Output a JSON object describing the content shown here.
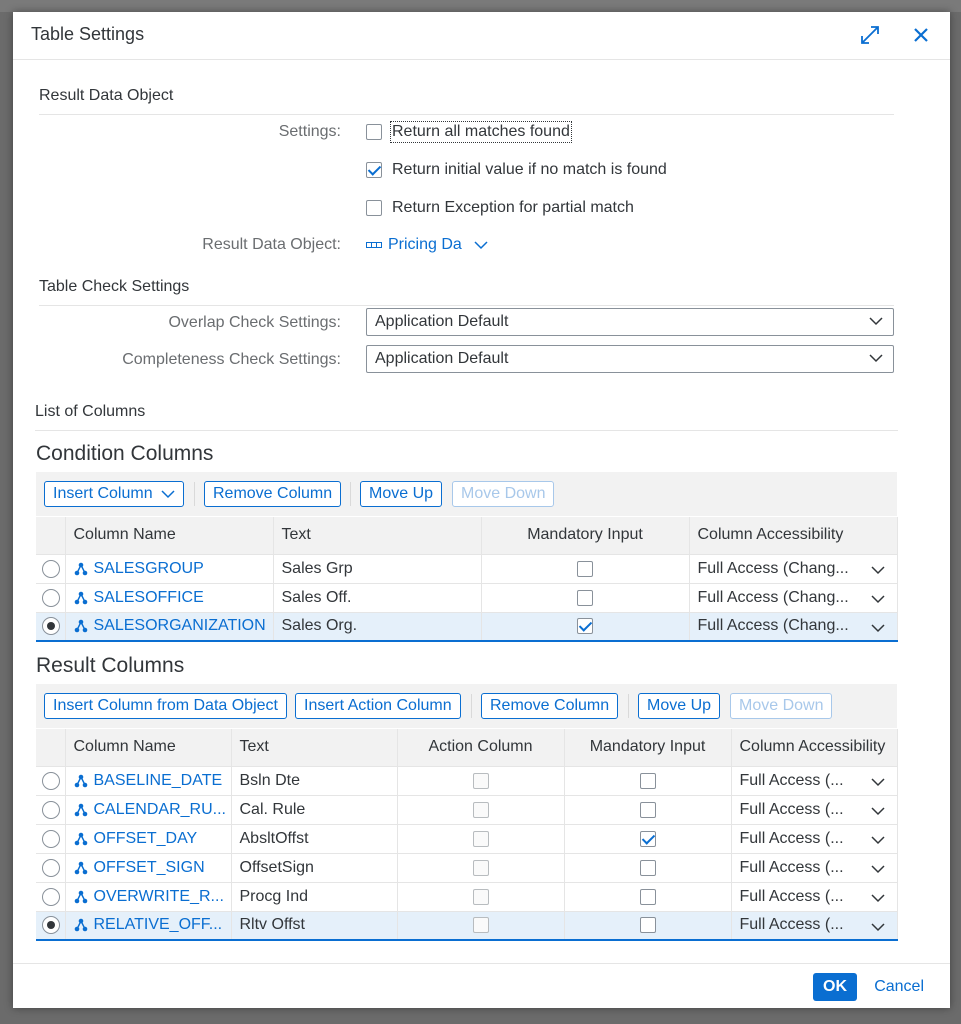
{
  "dialog": {
    "title": "Table Settings",
    "ok_label": "OK",
    "cancel_label": "Cancel"
  },
  "result_data_object": {
    "section_title": "Result Data Object",
    "settings_label": "Settings:",
    "options": [
      {
        "label": "Return all matches found",
        "checked": false
      },
      {
        "label": "Return initial value if no match is found",
        "checked": true
      },
      {
        "label": "Return Exception for partial match",
        "checked": false
      }
    ],
    "rdo_label": "Result Data Object:",
    "rdo_value": "Pricing Da"
  },
  "table_check": {
    "section_title": "Table Check Settings",
    "overlap_label": "Overlap Check Settings:",
    "overlap_value": "Application Default",
    "completeness_label": "Completeness Check Settings:",
    "completeness_value": "Application Default"
  },
  "list_of_columns": "List of Columns",
  "condition_columns": {
    "title": "Condition Columns",
    "toolbar": {
      "insert": "Insert Column",
      "remove": "Remove Column",
      "up": "Move Up",
      "down": "Move Down"
    },
    "headers": [
      "Column Name",
      "Text",
      "Mandatory Input",
      "Column Accessibility"
    ],
    "rows": [
      {
        "name": "SALESGROUP",
        "text": "Sales Grp",
        "mandatory": false,
        "access": "Full Access (Chang...",
        "selected": false
      },
      {
        "name": "SALESOFFICE",
        "text": "Sales Off.",
        "mandatory": false,
        "access": "Full Access (Chang...",
        "selected": false
      },
      {
        "name": "SALESORGANIZATION",
        "text": "Sales Org.",
        "mandatory": true,
        "access": "Full Access (Chang...",
        "selected": true
      }
    ]
  },
  "result_columns": {
    "title": "Result Columns",
    "toolbar": {
      "insert_from": "Insert Column from Data Object",
      "insert_action": "Insert Action Column",
      "remove": "Remove Column",
      "up": "Move Up",
      "down": "Move Down"
    },
    "headers": [
      "Column Name",
      "Text",
      "Action Column",
      "Mandatory Input",
      "Column Accessibility"
    ],
    "rows": [
      {
        "name": "BASELINE_DATE",
        "text": "Bsln Dte",
        "mandatory": false,
        "access": "Full Access (...",
        "selected": false
      },
      {
        "name": "CALENDAR_RU...",
        "text": "Cal. Rule",
        "mandatory": false,
        "access": "Full Access (...",
        "selected": false
      },
      {
        "name": "OFFSET_DAY",
        "text": "AbsltOffst",
        "mandatory": true,
        "access": "Full Access (...",
        "selected": false
      },
      {
        "name": "OFFSET_SIGN",
        "text": "OffsetSign",
        "mandatory": false,
        "access": "Full Access (...",
        "selected": false
      },
      {
        "name": "OVERWRITE_R...",
        "text": "Procg Ind",
        "mandatory": false,
        "access": "Full Access (...",
        "selected": false
      },
      {
        "name": "RELATIVE_OFF...",
        "text": "Rltv Offst",
        "mandatory": false,
        "access": "Full Access (...",
        "selected": true
      }
    ]
  },
  "icons": {
    "expand": "expand-icon",
    "close": "close-icon",
    "chevron": "chevron-down-icon",
    "column": "attribute-icon"
  },
  "colors": {
    "accent": "#0a6ed1",
    "selection": "#e5f0fa"
  }
}
